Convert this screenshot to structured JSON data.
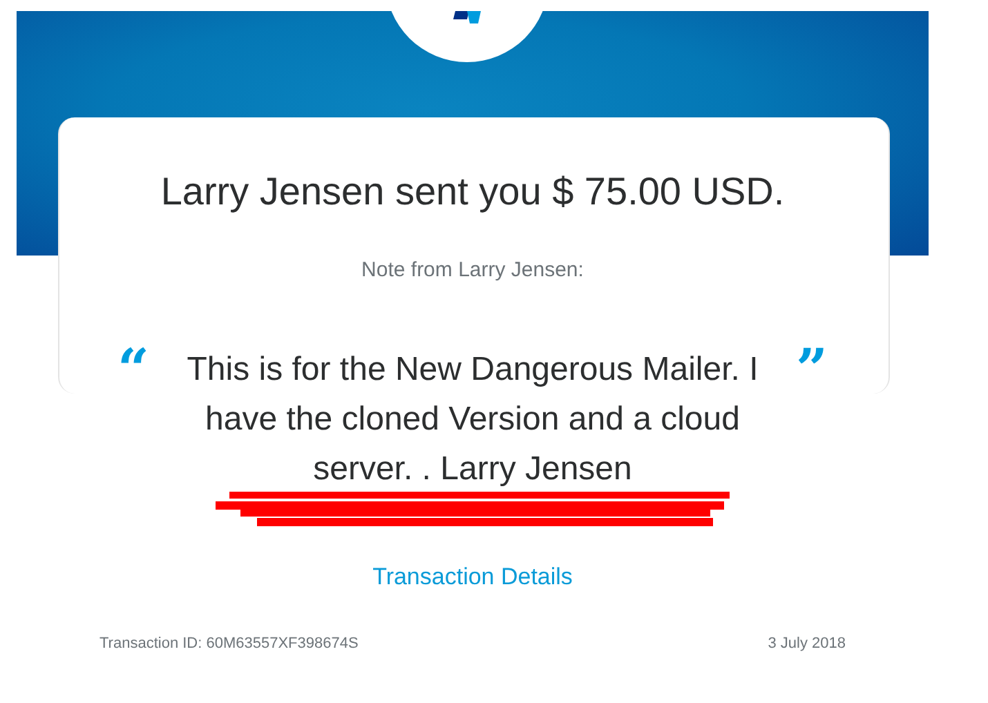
{
  "title": "Larry Jensen sent you $ 75.00 USD.",
  "note_label": "Note from Larry Jensen:",
  "note": {
    "open_quote": "“",
    "text": "This is for the New Dangerous Mailer. I have the cloned Version and a cloud server. . Larry Jensen",
    "close_quote": "”"
  },
  "link": "Transaction Details",
  "footer": {
    "transaction_id": "Transaction ID: 60M63557XF398674S",
    "date": "3 July 2018"
  }
}
